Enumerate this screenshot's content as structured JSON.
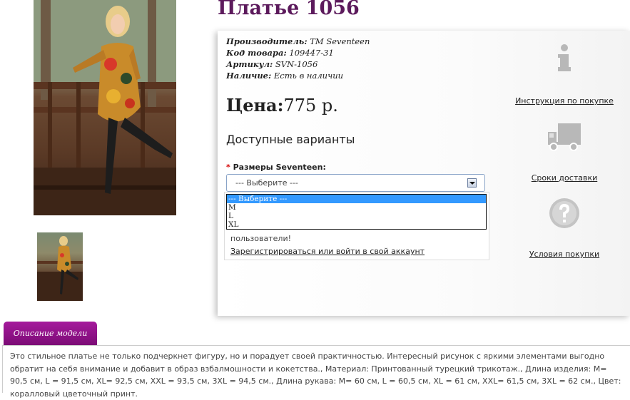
{
  "product": {
    "title": "Платье 1056",
    "manufacturer_label": "Производитель:",
    "manufacturer_value": "TM Seventeen",
    "code_label": "Код товара:",
    "code_value": "109447-31",
    "article_label": "Артикул:",
    "article_value": "SVN-1056",
    "stock_label": "Наличие:",
    "stock_value": "Есть в наличии",
    "price_label": "Цена:",
    "price_value": "775 р."
  },
  "options": {
    "heading": "Доступные варианты",
    "required_mark": "*",
    "size_label": "Размеры Seventeen:",
    "select_value": "--- Выберите ---",
    "dropdown_items": [
      "--- Выберите ---",
      "M",
      "L",
      "XL"
    ]
  },
  "login": {
    "text": "пользователи!",
    "link": "Зарегистрироваться или войти в свой аккаунт"
  },
  "side": {
    "instructions": "Инструкция по покупке",
    "delivery": "Сроки доставки",
    "terms": "Условия покупки"
  },
  "description": {
    "tab": "Описание модели",
    "text": "Это стильное платье не только подчеркнет фигуру, но и порадует своей практичностью. Интересный рисунок с яркими элементами выгодно обратит на себя внимание и добавит в образ взбалмошности и кокетства., Материал: Принтованный турецкий трикотаж., Длина изделия: M= 90,5 см, L = 91,5 см, XL= 92,5 см, XXL = 93,5 см, 3XL = 94,5 см., Длина рукава: M= 60 см, L = 60,5 см, XL = 61 см, XXL= 61,5 см, 3XL = 62 см., Цвет: коралловый цветочный принт."
  },
  "colors": {
    "title": "#5c1a5c",
    "tab": "#8e1488",
    "selected_option": "#3399ff"
  }
}
